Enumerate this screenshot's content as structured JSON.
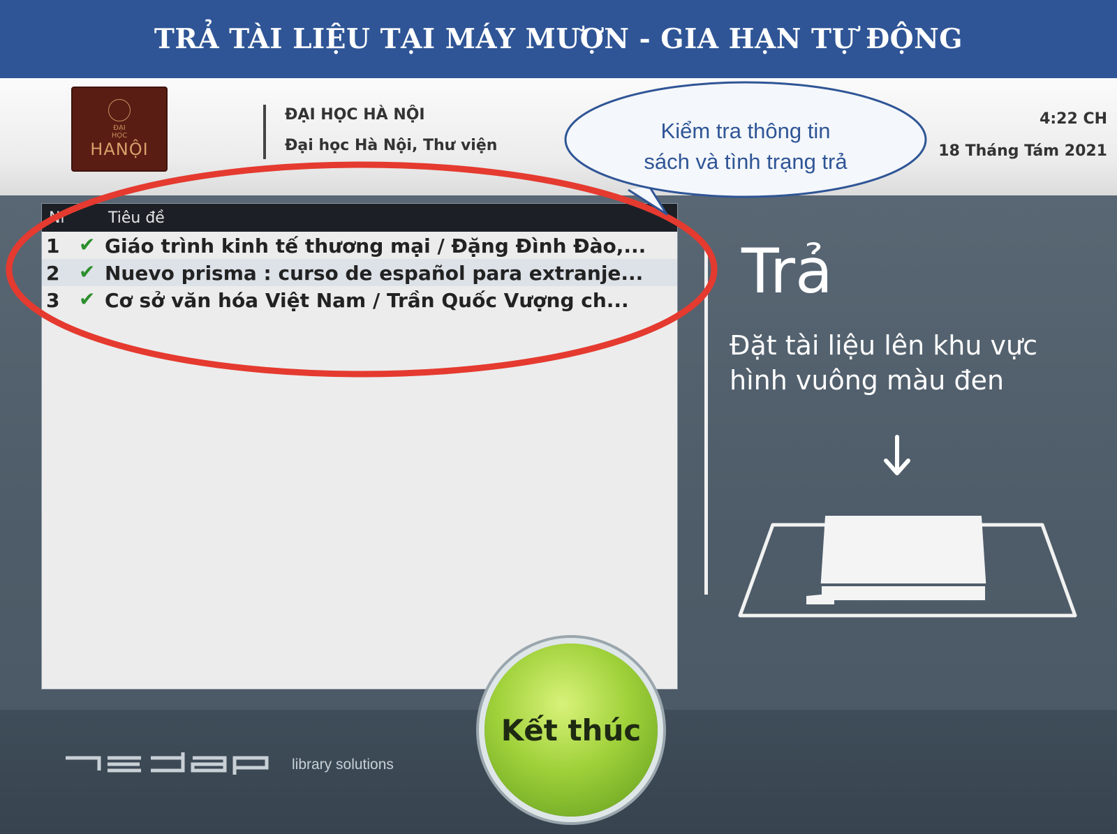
{
  "banner": {
    "title": "TRẢ TÀI LIỆU TẠI MÁY MƯỢN - GIA HẠN TỰ ĐỘNG"
  },
  "logo": {
    "line1": "ĐẠI",
    "line2": "HỌC",
    "line3": "HANỘI"
  },
  "header": {
    "org_name": "ĐẠI HỌC HÀ NỘI",
    "org_sub": "Đại học Hà Nội, Thư viện",
    "time": "4:22 CH",
    "date": "18 Tháng Tám 2021"
  },
  "callout": {
    "line1": "Kiểm tra thông tin",
    "line2": "sách và tình trạng trả"
  },
  "list": {
    "col_nr": "Nr",
    "col_title": "Tiêu đề",
    "rows": [
      {
        "nr": "1",
        "title": "Giáo trình kinh tế thương mại / Đặng Đình Đào,...",
        "status_icon": "check-icon"
      },
      {
        "nr": "2",
        "title": "Nuevo prisma : curso de español para extranje...",
        "status_icon": "check-icon"
      },
      {
        "nr": "3",
        "title": "Cơ sở văn hóa Việt Nam / Trần Quốc Vượng ch...",
        "status_icon": "check-icon"
      }
    ]
  },
  "return_panel": {
    "title": "Trả",
    "line1": "Đặt tài liệu lên khu vực",
    "line2": "hình vuông màu đen"
  },
  "end_button": {
    "label": "Kết thúc"
  },
  "brand": {
    "name": "nedap",
    "tagline": "library solutions"
  },
  "colors": {
    "banner": "#2f5596",
    "annotation_ring": "#e53a2f",
    "callout": "#2f5596",
    "button": "#9fd13a"
  }
}
